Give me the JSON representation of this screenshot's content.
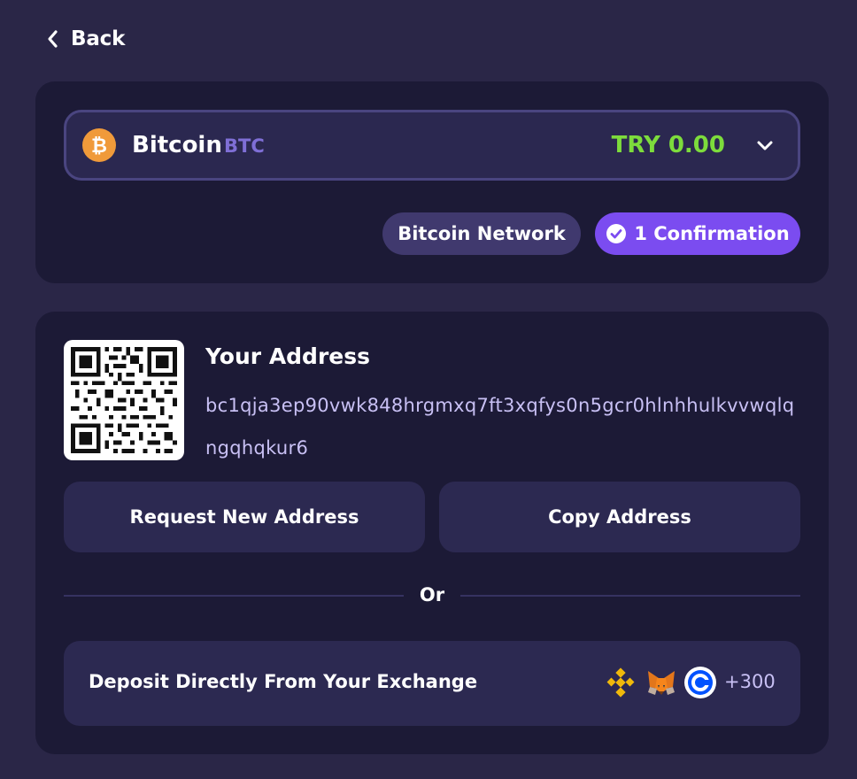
{
  "nav": {
    "back_label": "Back",
    "back_icon": "chevron-left-icon"
  },
  "currency": {
    "name": "Bitcoin",
    "ticker": "BTC",
    "balance": "TRY 0.00",
    "icon": "bitcoin-icon",
    "dropdown_icon": "chevron-down-icon"
  },
  "network": {
    "name": "Bitcoin Network",
    "confirmations": "1 Confirmation",
    "confirm_icon": "check-circle-icon"
  },
  "address": {
    "title": "Your Address",
    "value": "bc1qja3ep90vwk848hrgmxq7ft3xqfys0n5gcr0hlnhhulkvvwqlqngqhqkur6",
    "qr_icon": "qr-code-icon"
  },
  "actions": {
    "request_new": "Request New Address",
    "copy": "Copy Address"
  },
  "divider": {
    "text": "Or"
  },
  "exchange": {
    "label": "Deposit Directly From Your Exchange",
    "icons": [
      "binance-icon",
      "metamask-icon",
      "coinbase-icon"
    ],
    "more": "+300"
  },
  "colors": {
    "background": "#2a2647",
    "card": "#1c1a36",
    "accent_purple": "#7b4cf0",
    "balance_green": "#7ddc3c",
    "bitcoin_orange": "#f09a3a",
    "ticker_purple": "#7f6fd6"
  }
}
